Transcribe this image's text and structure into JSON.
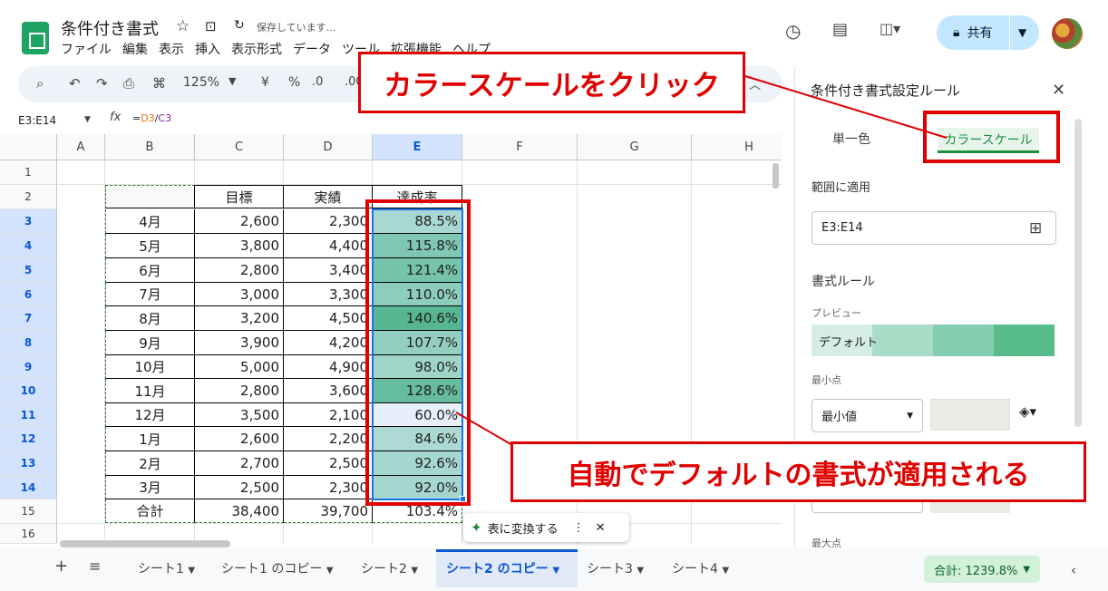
{
  "doc": {
    "title": "条件付き書式",
    "saving": "保存しています..."
  },
  "menu": [
    "ファイル",
    "編集",
    "表示",
    "挿入",
    "表示形式",
    "データ",
    "ツール",
    "拡張機能",
    "ヘルプ"
  ],
  "share_label": "共有",
  "toolbar": {
    "zoom": "125%",
    "currency": "¥",
    "percent": "%",
    "dec_dec": ".0",
    "dec_inc": ".00"
  },
  "formula_bar": {
    "name_box": "E3:E14",
    "fx": "fx",
    "eq": "=",
    "ref1": "D3",
    "slash": "/",
    "ref2": "C3"
  },
  "columns": [
    "A",
    "B",
    "C",
    "D",
    "E",
    "F",
    "G",
    "H"
  ],
  "rows": [
    "1",
    "2",
    "3",
    "4",
    "5",
    "6",
    "7",
    "8",
    "9",
    "10",
    "11",
    "12",
    "13",
    "14",
    "15",
    "16"
  ],
  "table": {
    "headers": [
      "目標",
      "実績",
      "達成率"
    ],
    "months": [
      "4月",
      "5月",
      "6月",
      "7月",
      "8月",
      "9月",
      "10月",
      "11月",
      "12月",
      "1月",
      "2月",
      "3月"
    ],
    "targets": [
      "2,600",
      "3,800",
      "2,800",
      "3,000",
      "3,200",
      "3,900",
      "5,000",
      "2,800",
      "3,500",
      "2,600",
      "2,700",
      "2,500"
    ],
    "actuals": [
      "2,300",
      "4,400",
      "3,400",
      "3,300",
      "4,500",
      "4,200",
      "4,900",
      "3,600",
      "2,100",
      "2,200",
      "2,500",
      "2,300"
    ],
    "rates": [
      "88.5%",
      "115.8%",
      "121.4%",
      "110.0%",
      "140.6%",
      "107.7%",
      "98.0%",
      "128.6%",
      "60.0%",
      "84.6%",
      "92.6%",
      "92.0%"
    ],
    "rate_colors": [
      "#a9d8d2",
      "#7fc7b4",
      "#75c3ab",
      "#8dcdbd",
      "#57b692",
      "#92cfc1",
      "#9fd4c9",
      "#66bc9e",
      "#e6f0fb",
      "#acd9d3",
      "#a5d6cf",
      "#a5d6cf"
    ],
    "total_label": "合計",
    "total_target": "38,400",
    "total_actual": "39,700",
    "total_rate": "103.4%"
  },
  "convert_chip": {
    "label": "表に変換する"
  },
  "sheets": [
    "シート1",
    "シート1 のコピー",
    "シート2",
    "シート2 のコピー",
    "シート3",
    "シート4"
  ],
  "sum_label": "合計: 1239.8%",
  "panel": {
    "title": "条件付き書式設定ルール",
    "tab_single": "単一色",
    "tab_scale": "カラースケール",
    "apply_range_label": "範囲に適用",
    "apply_range_value": "E3:E14",
    "format_rule_label": "書式ルール",
    "preview_label": "プレビュー",
    "preview_text": "デフォルト",
    "preview_colors": [
      "#d5ede5",
      "#a8dcc7",
      "#84cdb0",
      "#57bb8a"
    ],
    "min_label": "最小点",
    "min_value": "最小値",
    "min_color": "#ebeae4",
    "max_label": "最大点"
  },
  "annotations": {
    "callout_top": "カラースケールをクリック",
    "callout_bottom": "自動でデフォルトの書式が適用される"
  }
}
